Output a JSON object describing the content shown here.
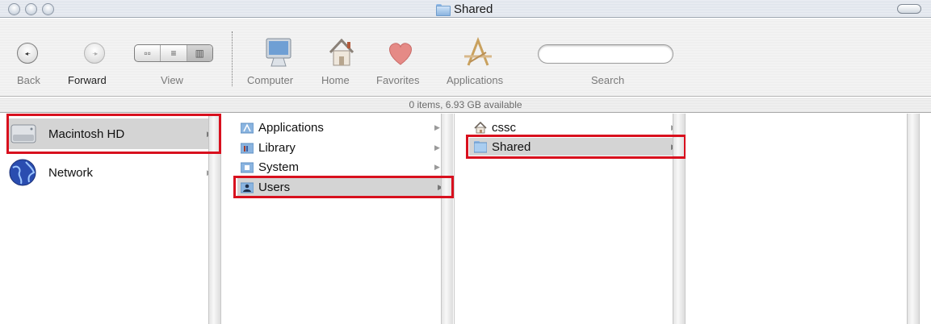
{
  "window": {
    "title": "Shared"
  },
  "toolbar": {
    "back_label": "Back",
    "forward_label": "Forward",
    "view_label": "View",
    "computer_label": "Computer",
    "home_label": "Home",
    "favorites_label": "Favorites",
    "applications_label": "Applications",
    "search_label": "Search",
    "search_value": ""
  },
  "status": {
    "text": "0 items, 6.93 GB available"
  },
  "columns": {
    "volumes": [
      {
        "label": "Macintosh HD",
        "icon": "hard-drive-icon",
        "selected": true
      },
      {
        "label": "Network",
        "icon": "globe-icon",
        "selected": false
      }
    ],
    "root": [
      {
        "label": "Applications",
        "icon": "applications-folder-icon",
        "selected": false
      },
      {
        "label": "Library",
        "icon": "library-folder-icon",
        "selected": false
      },
      {
        "label": "System",
        "icon": "system-folder-icon",
        "selected": false
      },
      {
        "label": "Users",
        "icon": "users-folder-icon",
        "selected": true
      }
    ],
    "users": [
      {
        "label": "cssc",
        "icon": "home-icon",
        "selected": false
      },
      {
        "label": "Shared",
        "icon": "folder-icon",
        "selected": true
      }
    ]
  },
  "colors": {
    "highlight_border": "#d8101e",
    "selection": "#d4d4d4"
  }
}
